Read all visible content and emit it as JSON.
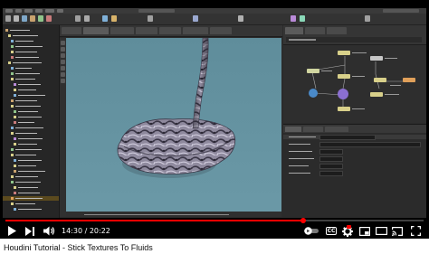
{
  "video": {
    "title": "Houdini Tutorial - Stick Textures To Fluids",
    "time_current": "14:30",
    "time_separator": " / ",
    "time_total": "20:22",
    "progress_fraction": 0.712,
    "accent_color": "#ff0000"
  },
  "controls": {
    "play_icon": "play-icon",
    "next_icon": "skip-next-icon",
    "volume_icon": "volume-icon",
    "autoplay_icon": "autoplay-toggle-icon",
    "captions_icon": "subtitles-icon",
    "captions_label": "CC",
    "settings_icon": "gear-icon",
    "miniplayer_icon": "miniplayer-icon",
    "theater_icon": "theater-mode-icon",
    "cast_icon": "cast-icon",
    "fullscreen_icon": "fullscreen-icon"
  },
  "houdini": {
    "viewport_bg_top": "#5f8d9b",
    "viewport_bg_bottom": "#6b99a7",
    "mesh_color": "#8f8a9e",
    "node_colors": [
      "#d8d08a",
      "#c7c7c7",
      "#d0d5a0",
      "#8b6fd1",
      "#4a8ac9",
      "#e0a05a"
    ]
  }
}
